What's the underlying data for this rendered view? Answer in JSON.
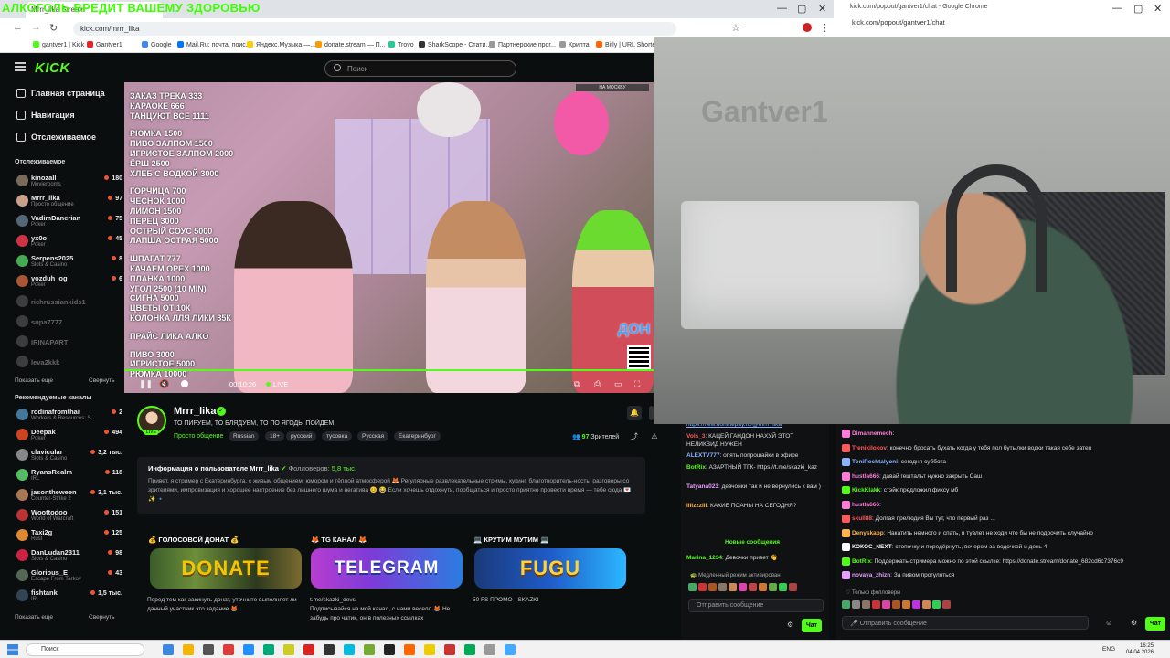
{
  "overlay_title": "АЛКОГОЛЬ ВРЕДИТ ВАШЕМУ ЗДОРОВЬЮ",
  "browser1": {
    "tab_title": "Mrrr_lika Stream",
    "url": "kick.com/mrrr_lika",
    "bookmarks": [
      "gantver1 | Kick",
      "Gantver1",
      "Google",
      "Mail.Ru: почта, поис...",
      "Яндекс.Музыка —...",
      "donate.stream — П...",
      "Trovo",
      "SharkScope - Стати...",
      "Партнерские прог...",
      "Крипта",
      "Bitly | URL Shortener"
    ]
  },
  "browser2": {
    "tab_title": "kick.com/popout/gantver1/chat - Google Chrome",
    "url": "kick.com/popout/gantver1/chat"
  },
  "kick": {
    "logo": "KICK",
    "search_placeholder": "Поиск",
    "nav": [
      "Главная страница",
      "Навигация",
      "Отслеживаемое"
    ],
    "followed_header": "Отслеживаемое",
    "followed": [
      {
        "name": "kinozall",
        "game": "Movierooms",
        "viewers": "180",
        "color": "#7a6a5a"
      },
      {
        "name": "Mrrr_lika",
        "game": "Просто общение",
        "viewers": "97",
        "color": "#c8a08c"
      },
      {
        "name": "VadimDanerian",
        "game": "Poker",
        "viewers": "75",
        "color": "#556677"
      },
      {
        "name": "yx0o",
        "game": "Poker",
        "viewers": "45",
        "color": "#cc3344"
      },
      {
        "name": "Serpens2025",
        "game": "Slots & Casino",
        "viewers": "8",
        "color": "#44aa55"
      },
      {
        "name": "vozduh_og",
        "game": "Poker",
        "viewers": "6",
        "color": "#aa5533"
      }
    ],
    "offline": [
      "richrussiankids1",
      "supa7777",
      "IRINAPART",
      "leva2kkk"
    ],
    "show_more": "Показать еще",
    "collapse": "Свернуть",
    "recommended_header": "Рекомендуемые каналы",
    "recommended": [
      {
        "name": "rodinafromthai",
        "game": "Workers & Resources: S...",
        "viewers": "2",
        "color": "#447799"
      },
      {
        "name": "Deepak",
        "game": "Poker",
        "viewers": "494",
        "color": "#cc4422"
      },
      {
        "name": "claviculаr",
        "game": "Slots & Casino",
        "viewers": "3,2 тыс.",
        "color": "#888888"
      },
      {
        "name": "RyansRealm",
        "game": "IRL",
        "viewers": "118",
        "color": "#55bb66"
      },
      {
        "name": "jasontheween",
        "game": "Counter-Strike 2",
        "viewers": "3,1 тыс.",
        "color": "#aa7755"
      },
      {
        "name": "Woottodoo",
        "game": "World of Warcraft",
        "viewers": "151",
        "color": "#bb3333"
      },
      {
        "name": "Taxi2g",
        "game": "Rust",
        "viewers": "125",
        "color": "#dd8833"
      },
      {
        "name": "DanLudan2311",
        "game": "Slots & Casino",
        "viewers": "98",
        "color": "#cc2244"
      },
      {
        "name": "Glorious_E",
        "game": "Escape From Tarkov",
        "viewers": "43",
        "color": "#556655"
      },
      {
        "name": "fishtank",
        "game": "IRL",
        "viewers": "1,5 тыс.",
        "color": "#334455"
      }
    ]
  },
  "video": {
    "menu_groups": [
      [
        "ЗАКАЗ ТРЕКА 333",
        "КАРАОКЕ 666",
        "ТАНЦУЮТ ВСЕ 1111"
      ],
      [
        "РЮМКА 1500",
        "ПИВО ЗАЛПОМ 1500",
        "ИГРИСТОЕ ЗАЛПОМ 2000",
        "ЁРШ 2500",
        "ХЛЕБ С ВОДКОЙ 3000"
      ],
      [
        "ГОРЧИЦА 700",
        "ЧЕСНОК 1000",
        "ЛИМОН 1500",
        "ПЕРЕЦ 3000",
        "ОСТРЫЙ СОУС 5000",
        "ЛАПША ОСТРАЯ 5000"
      ],
      [
        "ШПАГАТ 777",
        "КАЧАЕМ ОРЕХ 1000",
        "ПЛАНКА 1000",
        "УГОЛ 2500 (10 MIN)",
        "СИГНА 5000",
        "ЦВЕТЫ ОТ 10К",
        "КОЛОНКА ЛЛЯ ЛИКИ 35К"
      ],
      [
        "ПРАЙС ЛИКА АЛКО"
      ],
      [
        "ПИВО 3000",
        "ИГРИСТОЕ 5000",
        "РЮМКА 10000"
      ]
    ],
    "donation_bar": "НА МОСКВУ",
    "don_tag": "ДОН",
    "timecode": "00:10:26",
    "live": "LIVE"
  },
  "channel": {
    "name": "Mrrr_lika",
    "live_badge": "LIVE",
    "title": "ТО ПИРУЕМ, ТО БЛЯДУЕМ, ТО ПО ЯГОДЫ ПОЙДЕМ",
    "category": "Просто общение",
    "tags": [
      "Russian",
      "18+",
      "русский",
      "тусовка",
      "Русская",
      "Екатеринбург"
    ],
    "viewers_count": "97",
    "viewers_label": "Зрителей"
  },
  "about": {
    "title": "Информация о пользователе Mrrr_lika",
    "followers_label": "Фолловеров:",
    "followers": "5,8 тыс.",
    "text": "Привет, я стример с Екатеринбурга, с живым общением, юмором и тёплой атмосферой 🦊 Регулярные развлекательные стримы, кукинг, благотворитель-ность, разговоры со зрителями, импровизация и хорошее настроение без лишнего шума и негатива 😊 😂 Если хочешь отдохнуть, пообщаться и просто приятно провести время — тебе сюда 💌 ✨ 🔹"
  },
  "panels": [
    {
      "header": "💰 ГОЛОСОВОЙ ДОНАТ 💰",
      "banner": "DONATE",
      "desc": "Перед тем как закинуть донат, уточните выполняет ли данный участник это задание 🦊",
      "color": "#f5c400"
    },
    {
      "header": "🦊 TG КАНАЛ 🦊",
      "banner": "TELEGRAM",
      "desc": "t.me/skazki_devs\nПодписывайся на мой канал, с нами весело 🦊 Не забудь про чатик, он в полезных ссылках",
      "color": "#3aa4ff"
    },
    {
      "header": "💻 КРУТИМ МУТИМ 💻",
      "banner": "FUGU",
      "desc": "50 FS ПРОМО - SKAZKI",
      "color": "#29c9ff"
    }
  ],
  "cam": {
    "watermark": "Gantver1"
  },
  "chat_left": {
    "messages": [
      {
        "user": "",
        "text": "https://new.donatepay.ru/@mrrr_lika",
        "color": "#8ab4ff",
        "link": true
      },
      {
        "user": "Vols_3",
        "text": "КАЦЕЙ ГАНДОН НАХУЙ ЭТОТ НЕЛИКВИД НУЖЕН",
        "color": "#ff5a5a"
      },
      {
        "user": "ALEXTV777",
        "text": "опять попрошайки в эфире",
        "color": "#8ab4ff"
      },
      {
        "user": "BotRix",
        "text": "АЗАРТНЫЙ ТГК- https://t.me/skazki_kaz",
        "color": "#53fc18"
      },
      {
        "user": "Tatyana023",
        "text": "девчонки так и не вернулись к вам )",
        "color": "#e8a0ff"
      },
      {
        "user": "lilizzzlii",
        "text": "КАКИЕ ПОАНЫ НА СЕГОДНЯ?",
        "color": "#ffb347"
      }
    ],
    "new_messages": "Новые сообщения",
    "after": {
      "user": "Marina_1234",
      "text": "Девочки привет 👋",
      "color": "#53fc18"
    },
    "mode": "Медленный режим активирован",
    "input_placeholder": "Отправить сообщение",
    "send": "Чат"
  },
  "chat_right": {
    "messages": [
      {
        "user": "Dimannemech",
        "text": "",
        "color": "#ff7ad9"
      },
      {
        "user": "Trenikilokov",
        "text": "конечно бросать бухать когда у тебя пол бутылки водки такая себе затея",
        "color": "#ff5a5a"
      },
      {
        "user": "ToniPochtalyoni",
        "text": "сегодня суббота",
        "color": "#8ab4ff"
      },
      {
        "user": "hustla666",
        "text": "давай гештальт нужно закрыть Саш",
        "color": "#ff7ad9"
      },
      {
        "user": "KickKlakk",
        "text": "стэйк предложил фиксу мб",
        "color": "#53fc18"
      },
      {
        "user": "hustla666",
        "text": "",
        "color": "#ff7ad9"
      },
      {
        "user": "skull88",
        "text": "Долгая прелюдия Вы тут, что первый раз ...",
        "color": "#ff5a5a"
      },
      {
        "user": "Denyskapp",
        "text": "Накатить немного и спать, в тувлет не ходи что бы не подрочить случайно",
        "color": "#ffb347"
      },
      {
        "user": "КОКОС_NEXT",
        "text": "стопочку и передёрнуть, вечером за водочкой и день 4",
        "color": "#ffffff"
      },
      {
        "user": "BotRix",
        "text": "Поддержать стримера можно по этой ссылке: https://donate.stream/donate_682cd6c7376c9",
        "color": "#53fc18"
      },
      {
        "user": "novaya_zhizn",
        "text": "За пивом прогуляться",
        "color": "#e8a0ff"
      }
    ],
    "mode": "Только фолловеры",
    "input_placeholder": "Отправить сообщение",
    "send": "Чат"
  },
  "taskbar": {
    "search": "Поиск",
    "lang": "ENG",
    "time": "16:25",
    "date": "04.04.2026"
  }
}
